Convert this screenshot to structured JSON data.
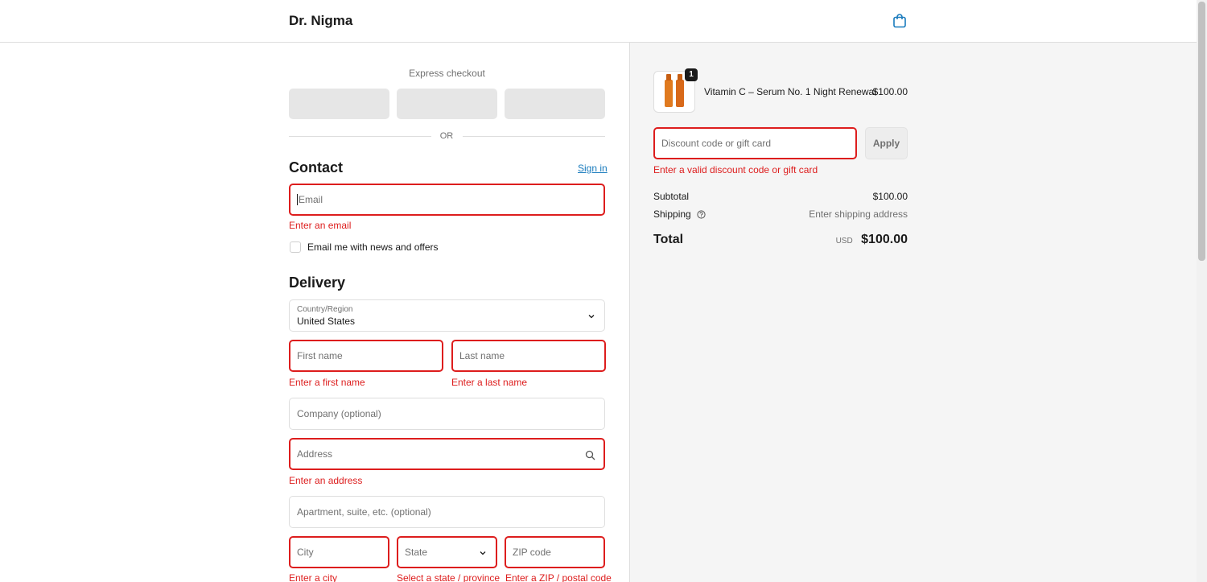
{
  "header": {
    "brand": "Dr. Nigma"
  },
  "express": {
    "label": "Express checkout",
    "divider_text": "OR"
  },
  "contact": {
    "title": "Contact",
    "signin_label": "Sign in",
    "email_placeholder": "Email",
    "email_error": "Enter an email",
    "newsletter_label": "Email me with news and offers"
  },
  "delivery": {
    "title": "Delivery",
    "country_label": "Country/Region",
    "country_value": "United States",
    "first_name_placeholder": "First name",
    "first_name_error": "Enter a first name",
    "last_name_placeholder": "Last name",
    "last_name_error": "Enter a last name",
    "company_placeholder": "Company (optional)",
    "address_placeholder": "Address",
    "address_error": "Enter an address",
    "apartment_placeholder": "Apartment, suite, etc. (optional)",
    "city_placeholder": "City",
    "city_error": "Enter a city",
    "state_placeholder": "State",
    "state_error": "Select a state / province",
    "zip_placeholder": "ZIP code",
    "zip_error": "Enter a ZIP / postal code"
  },
  "summary": {
    "product_name": "Vitamin C – Serum No. 1 Night Renewal",
    "product_price": "$100.00",
    "quantity": "1",
    "discount_placeholder": "Discount code or gift card",
    "discount_error": "Enter a valid discount code or gift card",
    "apply_label": "Apply",
    "subtotal_label": "Subtotal",
    "subtotal_value": "$100.00",
    "shipping_label": "Shipping",
    "shipping_value": "Enter shipping address",
    "total_label": "Total",
    "currency": "USD",
    "total_value": "$100.00"
  },
  "colors": {
    "error": "#dd1d1d",
    "link": "#197bbd",
    "accent_icon": "#197bbd"
  }
}
